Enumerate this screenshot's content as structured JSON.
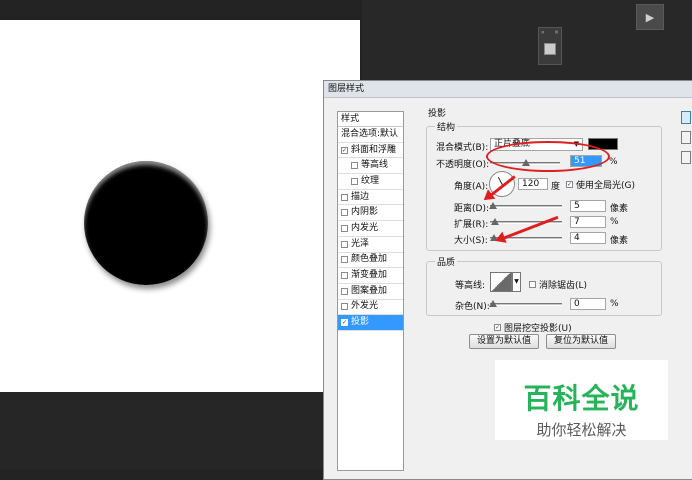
{
  "workspace": {
    "play_icon": "play-icon",
    "mini_panel_expand": "»",
    "mini_panel_close": "×"
  },
  "dialog": {
    "title": "图层样式",
    "styles": {
      "header": "样式",
      "items": [
        {
          "label": "混合选项:默认",
          "checkbox": false,
          "checked": false
        },
        {
          "label": "斜面和浮雕",
          "checkbox": true,
          "checked": true
        },
        {
          "label": "等高线",
          "checkbox": true,
          "checked": false,
          "indent": true
        },
        {
          "label": "纹理",
          "checkbox": true,
          "checked": false,
          "indent": true
        },
        {
          "label": "描边",
          "checkbox": true,
          "checked": false
        },
        {
          "label": "内阴影",
          "checkbox": true,
          "checked": false
        },
        {
          "label": "内发光",
          "checkbox": true,
          "checked": false
        },
        {
          "label": "光泽",
          "checkbox": true,
          "checked": false
        },
        {
          "label": "颜色叠加",
          "checkbox": true,
          "checked": false
        },
        {
          "label": "渐变叠加",
          "checkbox": true,
          "checked": false
        },
        {
          "label": "图案叠加",
          "checkbox": true,
          "checked": false
        },
        {
          "label": "外发光",
          "checkbox": true,
          "checked": false
        },
        {
          "label": "投影",
          "checkbox": true,
          "checked": true,
          "selected": true
        }
      ]
    },
    "drop_shadow": {
      "section_title": "投影",
      "structure": {
        "title": "结构",
        "blend_mode_label": "混合模式(B):",
        "blend_mode_value": "正片叠底",
        "blend_color": "#000000",
        "opacity_label": "不透明度(O):",
        "opacity_value": "51",
        "opacity_unit": "%",
        "opacity_fraction": 0.51,
        "angle_label": "角度(A):",
        "angle_value": "120",
        "angle_unit": "度",
        "global_light_label": "使用全局光(G)",
        "global_light_checked": true,
        "distance_label": "距离(D):",
        "distance_value": "5",
        "distance_unit": "像素",
        "spread_label": "扩展(R):",
        "spread_value": "7",
        "spread_unit": "%",
        "size_label": "大小(S):",
        "size_value": "4",
        "size_unit": "像素"
      },
      "quality": {
        "title": "品质",
        "contour_label": "等高线:",
        "antialias_label": "消除锯齿(L)",
        "antialias_checked": false,
        "noise_label": "杂色(N):",
        "noise_value": "0",
        "noise_unit": "%"
      },
      "knockout_label": "图层挖空投影(U)",
      "knockout_checked": true,
      "make_default_label": "设置为默认值",
      "reset_default_label": "复位为默认值"
    }
  },
  "watermark": {
    "title": "百科全说",
    "subtitle": "助你轻松解决"
  },
  "colors": {
    "accent_selected": "#3399ff",
    "annotation_red": "#e02020",
    "watermark_green": "#27b35a"
  }
}
